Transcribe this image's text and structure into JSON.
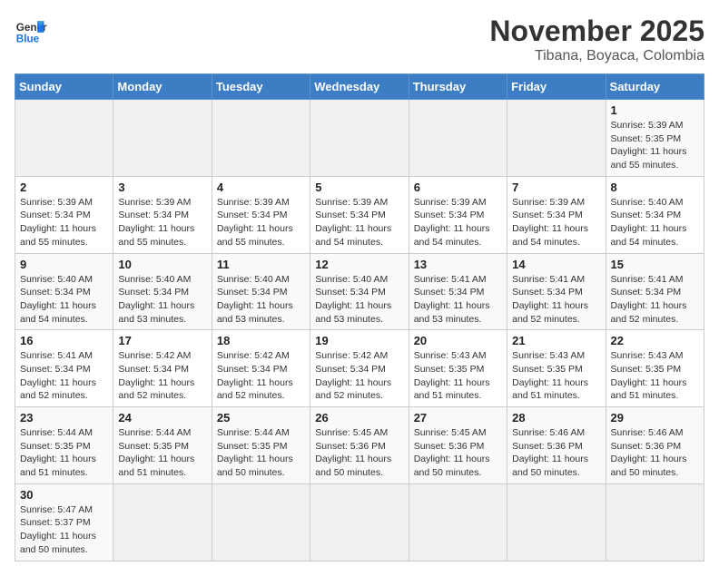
{
  "logo": {
    "text_general": "General",
    "text_blue": "Blue"
  },
  "header": {
    "month": "November 2025",
    "location": "Tibana, Boyaca, Colombia"
  },
  "weekdays": [
    "Sunday",
    "Monday",
    "Tuesday",
    "Wednesday",
    "Thursday",
    "Friday",
    "Saturday"
  ],
  "weeks": [
    [
      {
        "day": "",
        "sunrise": "",
        "sunset": "",
        "daylight": ""
      },
      {
        "day": "",
        "sunrise": "",
        "sunset": "",
        "daylight": ""
      },
      {
        "day": "",
        "sunrise": "",
        "sunset": "",
        "daylight": ""
      },
      {
        "day": "",
        "sunrise": "",
        "sunset": "",
        "daylight": ""
      },
      {
        "day": "",
        "sunrise": "",
        "sunset": "",
        "daylight": ""
      },
      {
        "day": "",
        "sunrise": "",
        "sunset": "",
        "daylight": ""
      },
      {
        "day": "1",
        "sunrise": "5:39 AM",
        "sunset": "5:35 PM",
        "daylight": "11 hours and 55 minutes."
      }
    ],
    [
      {
        "day": "2",
        "sunrise": "5:39 AM",
        "sunset": "5:34 PM",
        "daylight": "11 hours and 55 minutes."
      },
      {
        "day": "3",
        "sunrise": "5:39 AM",
        "sunset": "5:34 PM",
        "daylight": "11 hours and 55 minutes."
      },
      {
        "day": "4",
        "sunrise": "5:39 AM",
        "sunset": "5:34 PM",
        "daylight": "11 hours and 55 minutes."
      },
      {
        "day": "5",
        "sunrise": "5:39 AM",
        "sunset": "5:34 PM",
        "daylight": "11 hours and 54 minutes."
      },
      {
        "day": "6",
        "sunrise": "5:39 AM",
        "sunset": "5:34 PM",
        "daylight": "11 hours and 54 minutes."
      },
      {
        "day": "7",
        "sunrise": "5:39 AM",
        "sunset": "5:34 PM",
        "daylight": "11 hours and 54 minutes."
      },
      {
        "day": "8",
        "sunrise": "5:40 AM",
        "sunset": "5:34 PM",
        "daylight": "11 hours and 54 minutes."
      }
    ],
    [
      {
        "day": "9",
        "sunrise": "5:40 AM",
        "sunset": "5:34 PM",
        "daylight": "11 hours and 54 minutes."
      },
      {
        "day": "10",
        "sunrise": "5:40 AM",
        "sunset": "5:34 PM",
        "daylight": "11 hours and 53 minutes."
      },
      {
        "day": "11",
        "sunrise": "5:40 AM",
        "sunset": "5:34 PM",
        "daylight": "11 hours and 53 minutes."
      },
      {
        "day": "12",
        "sunrise": "5:40 AM",
        "sunset": "5:34 PM",
        "daylight": "11 hours and 53 minutes."
      },
      {
        "day": "13",
        "sunrise": "5:41 AM",
        "sunset": "5:34 PM",
        "daylight": "11 hours and 53 minutes."
      },
      {
        "day": "14",
        "sunrise": "5:41 AM",
        "sunset": "5:34 PM",
        "daylight": "11 hours and 52 minutes."
      },
      {
        "day": "15",
        "sunrise": "5:41 AM",
        "sunset": "5:34 PM",
        "daylight": "11 hours and 52 minutes."
      }
    ],
    [
      {
        "day": "16",
        "sunrise": "5:41 AM",
        "sunset": "5:34 PM",
        "daylight": "11 hours and 52 minutes."
      },
      {
        "day": "17",
        "sunrise": "5:42 AM",
        "sunset": "5:34 PM",
        "daylight": "11 hours and 52 minutes."
      },
      {
        "day": "18",
        "sunrise": "5:42 AM",
        "sunset": "5:34 PM",
        "daylight": "11 hours and 52 minutes."
      },
      {
        "day": "19",
        "sunrise": "5:42 AM",
        "sunset": "5:34 PM",
        "daylight": "11 hours and 52 minutes."
      },
      {
        "day": "20",
        "sunrise": "5:43 AM",
        "sunset": "5:35 PM",
        "daylight": "11 hours and 51 minutes."
      },
      {
        "day": "21",
        "sunrise": "5:43 AM",
        "sunset": "5:35 PM",
        "daylight": "11 hours and 51 minutes."
      },
      {
        "day": "22",
        "sunrise": "5:43 AM",
        "sunset": "5:35 PM",
        "daylight": "11 hours and 51 minutes."
      }
    ],
    [
      {
        "day": "23",
        "sunrise": "5:44 AM",
        "sunset": "5:35 PM",
        "daylight": "11 hours and 51 minutes."
      },
      {
        "day": "24",
        "sunrise": "5:44 AM",
        "sunset": "5:35 PM",
        "daylight": "11 hours and 51 minutes."
      },
      {
        "day": "25",
        "sunrise": "5:44 AM",
        "sunset": "5:35 PM",
        "daylight": "11 hours and 50 minutes."
      },
      {
        "day": "26",
        "sunrise": "5:45 AM",
        "sunset": "5:36 PM",
        "daylight": "11 hours and 50 minutes."
      },
      {
        "day": "27",
        "sunrise": "5:45 AM",
        "sunset": "5:36 PM",
        "daylight": "11 hours and 50 minutes."
      },
      {
        "day": "28",
        "sunrise": "5:46 AM",
        "sunset": "5:36 PM",
        "daylight": "11 hours and 50 minutes."
      },
      {
        "day": "29",
        "sunrise": "5:46 AM",
        "sunset": "5:36 PM",
        "daylight": "11 hours and 50 minutes."
      }
    ],
    [
      {
        "day": "30",
        "sunrise": "5:47 AM",
        "sunset": "5:37 PM",
        "daylight": "11 hours and 50 minutes."
      },
      {
        "day": "",
        "sunrise": "",
        "sunset": "",
        "daylight": ""
      },
      {
        "day": "",
        "sunrise": "",
        "sunset": "",
        "daylight": ""
      },
      {
        "day": "",
        "sunrise": "",
        "sunset": "",
        "daylight": ""
      },
      {
        "day": "",
        "sunrise": "",
        "sunset": "",
        "daylight": ""
      },
      {
        "day": "",
        "sunrise": "",
        "sunset": "",
        "daylight": ""
      },
      {
        "day": "",
        "sunrise": "",
        "sunset": "",
        "daylight": ""
      }
    ]
  ],
  "labels": {
    "sunrise": "Sunrise: ",
    "sunset": "Sunset: ",
    "daylight": "Daylight: "
  }
}
